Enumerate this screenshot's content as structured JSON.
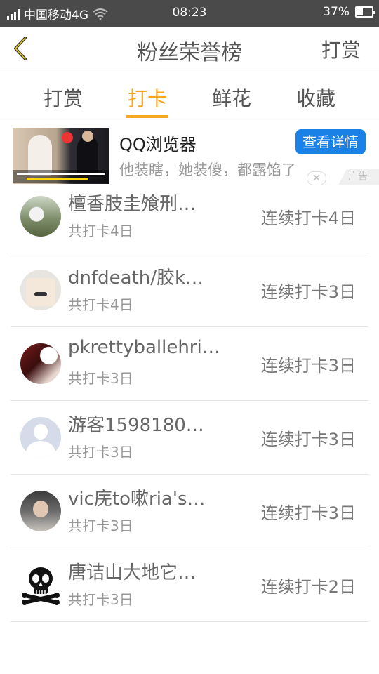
{
  "status_bar": {
    "carrier": "中国移动4G",
    "time": "08:23",
    "battery": "37%",
    "battery_level": 0.37
  },
  "header": {
    "title": "粉丝荣誉榜",
    "right_action": "打赏",
    "back_icon": "chevron-left-icon"
  },
  "tabs": [
    {
      "label": "打赏",
      "active": false
    },
    {
      "label": "打卡",
      "active": true
    },
    {
      "label": "鲜花",
      "active": false
    },
    {
      "label": "收藏",
      "active": false
    }
  ],
  "ad": {
    "title": "QQ浏览器",
    "description": "他装瞎，她装傻，都露馅了",
    "button": "查看详情",
    "close": "×",
    "tag": "广告"
  },
  "list": [
    {
      "name": "檀香肢圭飧刑…",
      "total": "共打卡4日",
      "streak": "连续打卡4日"
    },
    {
      "name": "dnfdeath/胶k…",
      "total": "共打卡4日",
      "streak": "连续打卡3日"
    },
    {
      "name": "pkrettyballehri…",
      "total": "共打卡3日",
      "streak": "连续打卡3日"
    },
    {
      "name": "游客1598180…",
      "total": "共打卡3日",
      "streak": "连续打卡3日"
    },
    {
      "name": "vic庑to嗽ria's…",
      "total": "共打卡3日",
      "streak": "连续打卡3日"
    },
    {
      "name": "唐诘山大地它…",
      "total": "共打卡3日",
      "streak": "连续打卡2日"
    }
  ],
  "colors": {
    "accent": "#f5a623",
    "ad_button": "#1a82e6",
    "status_bar": "#4a4a4a"
  }
}
